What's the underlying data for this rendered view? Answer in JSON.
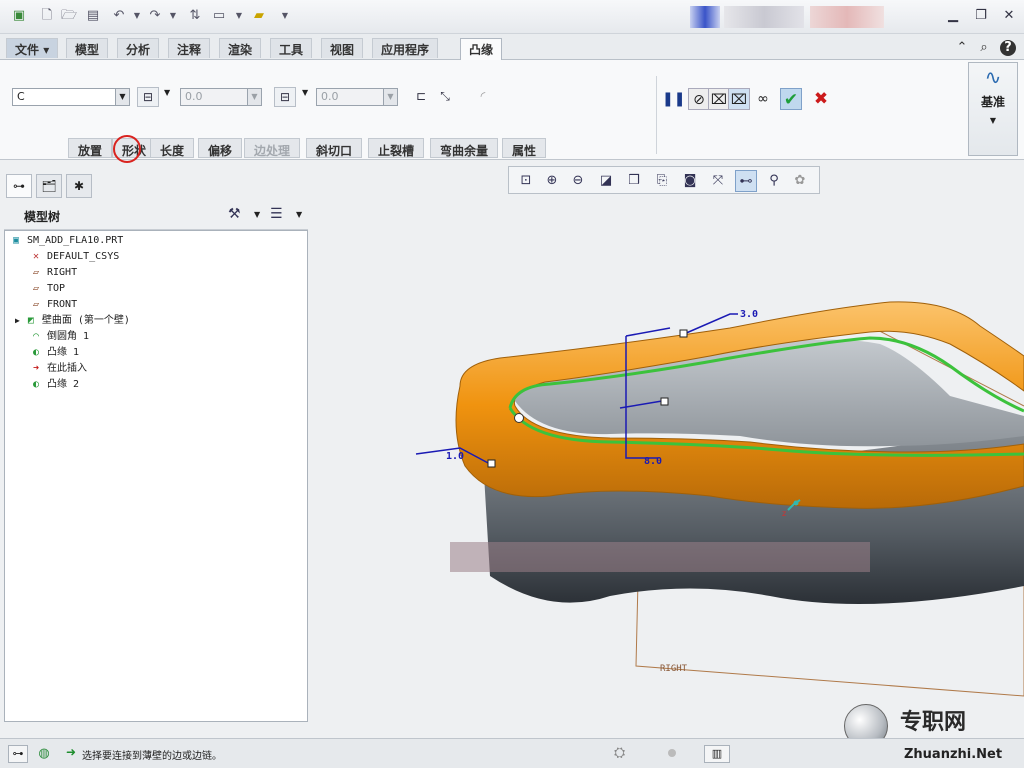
{
  "menu": {
    "file": "文件",
    "tabs": [
      "模型",
      "分析",
      "注释",
      "渲染",
      "工具",
      "视图",
      "应用程序"
    ],
    "active_tab": "凸缘"
  },
  "ribbon": {
    "shape_value": "C",
    "length1_value": "0.0",
    "length2_value": "0.0",
    "subtabs": [
      "放置",
      "形状",
      "长度",
      "偏移",
      "边处理",
      "斜切口",
      "止裂槽",
      "弯曲余量",
      "属性"
    ],
    "datum_label": "基准"
  },
  "panel": {
    "title": "模型树",
    "tree": [
      {
        "label": "SM_ADD_FLA10.PRT",
        "icon": "part-icon"
      },
      {
        "label": "DEFAULT_CSYS",
        "icon": "csys-icon"
      },
      {
        "label": "RIGHT",
        "icon": "plane-icon"
      },
      {
        "label": "TOP",
        "icon": "plane-icon"
      },
      {
        "label": "FRONT",
        "icon": "plane-icon"
      },
      {
        "label": "壁曲面 (第一个壁)",
        "icon": "wall-icon"
      },
      {
        "label": "倒圆角 1",
        "icon": "round-icon"
      },
      {
        "label": "凸缘 1",
        "icon": "flange-icon"
      },
      {
        "label": "在此插入",
        "icon": "insert-arrow-icon"
      },
      {
        "label": "凸缘 2",
        "icon": "flange-icon"
      }
    ]
  },
  "graphics": {
    "dim_top": "3.0",
    "dim_right": "8.0",
    "dim_left": "1.0",
    "plane_label": "RIGHT"
  },
  "status": {
    "message": "选择要连接到薄壁的边或边链。"
  },
  "watermark": {
    "brand": "专职网",
    "url": "Zhuanzhi.Net"
  },
  "colors": {
    "flange": "#f0930f",
    "highlight": "#3cc23c",
    "dimension": "#1a1ab4",
    "accept": "#1e9e3a",
    "cancel": "#cc1b1b"
  }
}
